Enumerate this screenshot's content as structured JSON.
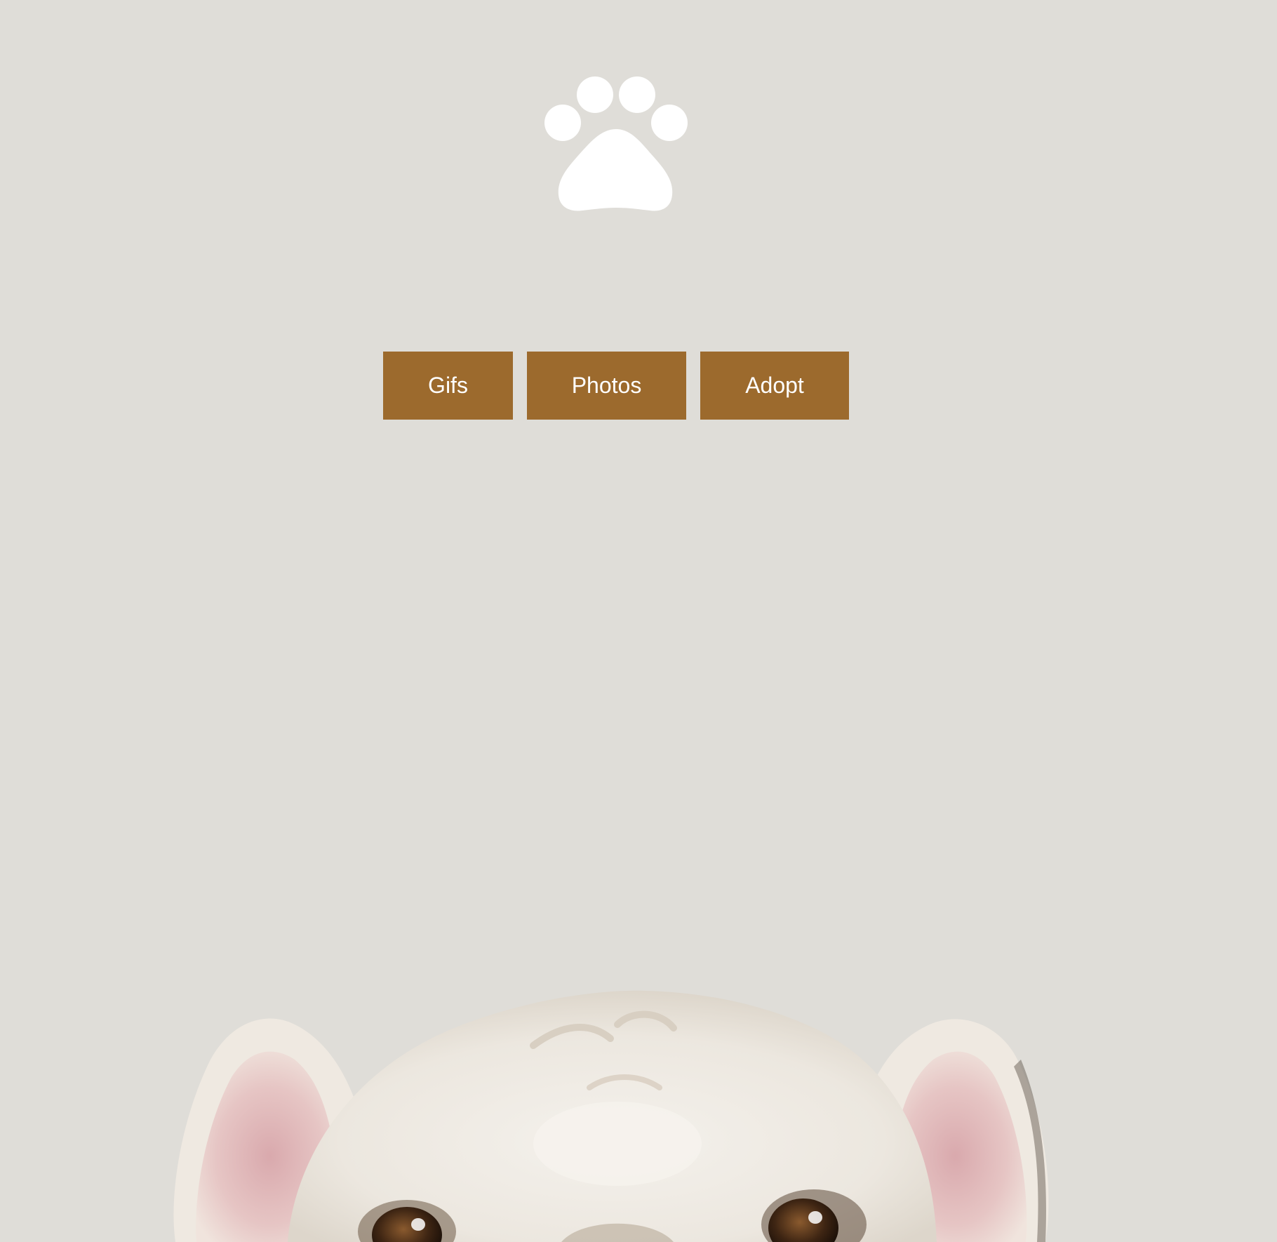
{
  "logo": {
    "icon": "paw-icon",
    "color": "#ffffff"
  },
  "nav": {
    "items": [
      {
        "label": "Gifs"
      },
      {
        "label": "Photos"
      },
      {
        "label": "Adopt"
      }
    ],
    "button_color": "#9c6a2d",
    "text_color": "#ffffff"
  },
  "background_color": "#dfddd8",
  "hero_image": {
    "icon": "bulldog-photo"
  }
}
